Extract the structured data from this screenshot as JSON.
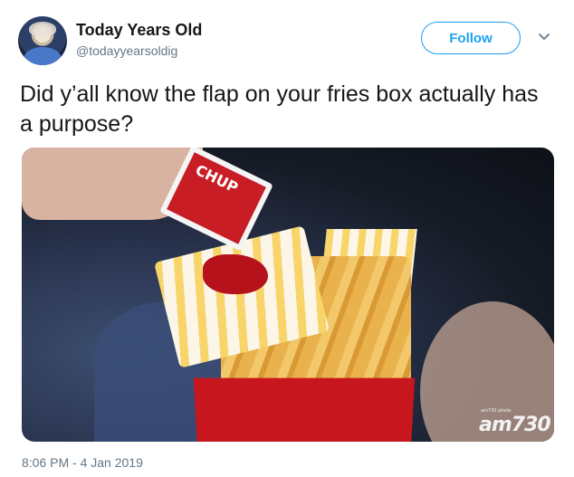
{
  "author": {
    "display_name": "Today Years Old",
    "handle": "@todayyearsoldig",
    "avatar_icon": "profile-photo"
  },
  "actions": {
    "follow_label": "Follow",
    "more_icon": "chevron-down-icon"
  },
  "tweet": {
    "text": "Did y’all know the flap on your fries box actually has a purpose?",
    "timestamp": "8:06 PM - 4 Jan 2019"
  },
  "media": {
    "packet_text": "CHUP",
    "watermark": "am730",
    "watermark_small": "am730 photo"
  },
  "colors": {
    "accent": "#1da1f2",
    "text": "#14171a",
    "secondary": "#657786"
  }
}
